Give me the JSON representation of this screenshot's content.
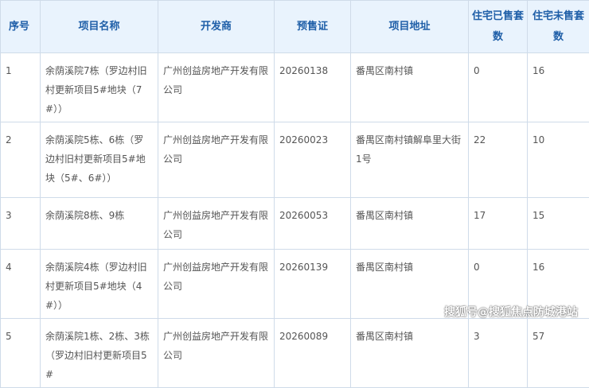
{
  "table": {
    "headers": [
      "序号",
      "项目名称",
      "开发商",
      "预售证",
      "项目地址",
      "住宅已售套数",
      "住宅未售套数"
    ],
    "rows": [
      [
        "1",
        "余荫溪院7栋（罗边村旧村更新项目5#地块（7#））",
        "广州创益房地产开发有限公司",
        "20260138",
        "番禺区南村镇",
        "0",
        "16"
      ],
      [
        "2",
        "余荫溪院5栋、6栋（罗边村旧村更新项目5#地块（5#、6#））",
        "广州创益房地产开发有限公司",
        "20260023",
        "番禺区南村镇解阜里大街1号",
        "22",
        "10"
      ],
      [
        "3",
        "余荫溪院8栋、9栋",
        "广州创益房地产开发有限公司",
        "20260053",
        "番禺区南村镇",
        "17",
        "15"
      ],
      [
        "4",
        "余荫溪院4栋（罗边村旧村更新项目5#地块（4#））",
        "广州创益房地产开发有限公司",
        "20260139",
        "番禺区南村镇",
        "0",
        "16"
      ],
      [
        "5",
        "余荫溪院1栋、2栋、3栋（罗边村旧村更新项目5#",
        "广州创益房地产开发有限公司",
        "20260089",
        "番禺区南村镇",
        "3",
        "57"
      ]
    ]
  },
  "watermark": "搜狐号@搜狐焦点防城港站"
}
